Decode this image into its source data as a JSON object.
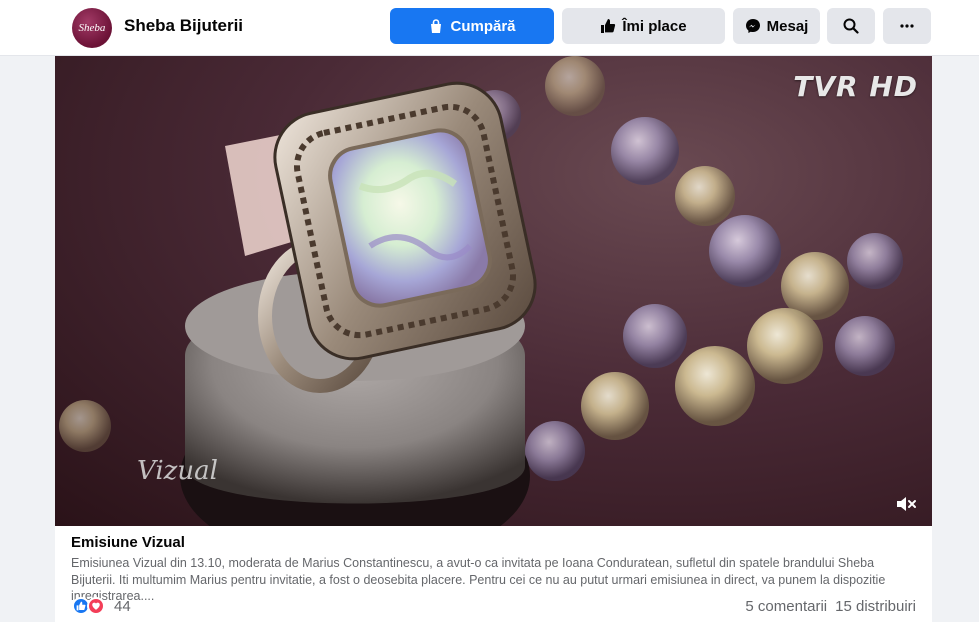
{
  "page": {
    "name": "Sheba Bijuterii",
    "avatar_text": "Sheba"
  },
  "actions": {
    "buy_label": "Cumpără",
    "like_label": "Îmi place",
    "message_label": "Mesaj"
  },
  "video": {
    "channel_logo": "TVR HD",
    "show_logo": "Vizual"
  },
  "post": {
    "title": "Emisiune Vizual",
    "text": "Emisiunea Vizual din 13.10, moderata de Marius Constantinescu, a avut-o ca invitata pe Ioana Conduratean, sufletul din spatele brandului Sheba Bijuterii. Iti multumim Marius pentru invitatie, a fost o deosebita placere. Pentru cei ce nu au putut urmari emisiunea in direct, va punem la dispozitie inregistrarea....",
    "reaction_count": "44",
    "comments": "5 comentarii",
    "shares": "15 distribuiri"
  },
  "colors": {
    "primary": "#1877f2",
    "love": "#f33e58",
    "secondary_bg": "#e4e6eb"
  }
}
